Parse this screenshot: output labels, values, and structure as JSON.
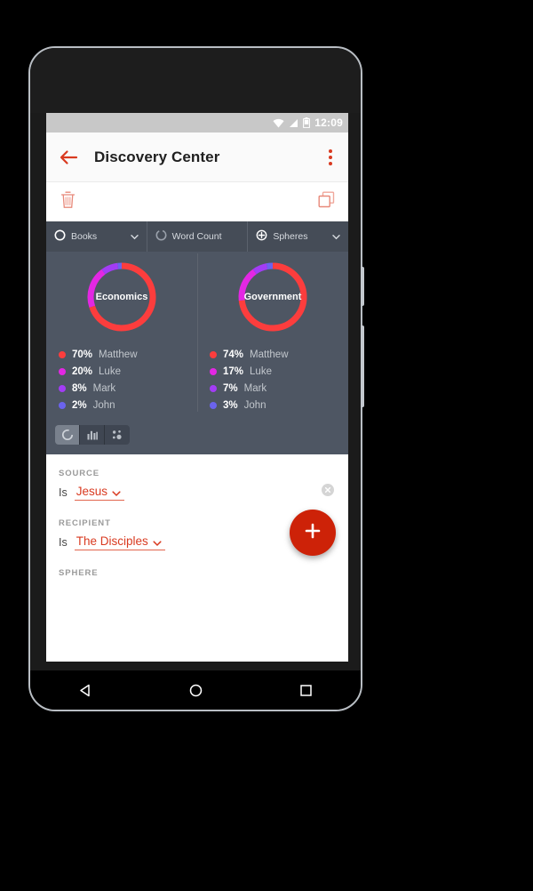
{
  "status_bar": {
    "time": "12:09",
    "icons": [
      "wifi-icon",
      "signal-icon",
      "battery-icon"
    ]
  },
  "app_bar": {
    "back_icon": "back-arrow-icon",
    "title": "Discovery Center",
    "overflow_icon": "overflow-menu-icon"
  },
  "action_toolbar": {
    "delete_icon": "trash-icon",
    "duplicate_icon": "copy-icon"
  },
  "tabs": [
    {
      "label": "Books",
      "icon": "circle-outline-icon",
      "caret": true
    },
    {
      "label": "Word Count",
      "icon": "circle-dashed-icon",
      "caret": false
    },
    {
      "label": "Spheres",
      "icon": "circle-plus-icon",
      "caret": true
    }
  ],
  "view_toggle": {
    "options": [
      "donut-chart-icon",
      "bar-chart-icon",
      "bubble-chart-icon"
    ],
    "active_index": 0
  },
  "filters": [
    {
      "label": "SOURCE",
      "operator": "Is",
      "value": "Jesus",
      "caret_icon": "chevron-down-icon",
      "clear_icon": "clear-circle-icon"
    },
    {
      "label": "RECIPIENT",
      "operator": "Is",
      "value": "The Disciples",
      "caret_icon": "chevron-down-icon"
    },
    {
      "label": "SPHERE"
    }
  ],
  "fab": {
    "icon": "plus-icon",
    "color": "#cd2208"
  },
  "nav_bar": {
    "back_icon": "nav-back-triangle-icon",
    "home_icon": "nav-home-circle-icon",
    "recents_icon": "nav-recents-square-icon"
  },
  "colors": {
    "accent": "#d93a20",
    "panel_bg": "#4e5663",
    "tab_bg": "#454c57",
    "series": [
      "#fc3d3d",
      "#e327e3",
      "#a33cf5",
      "#6b63ee"
    ]
  },
  "chart_data": {
    "type": "pie",
    "title": "",
    "legend_position": "below",
    "charts": [
      {
        "label": "Economics",
        "categories": [
          "Matthew",
          "Luke",
          "Mark",
          "John"
        ],
        "values": [
          70,
          20,
          8,
          2
        ],
        "unit": "%",
        "colors": [
          "#fc3d3d",
          "#e327e3",
          "#a33cf5",
          "#6b63ee"
        ]
      },
      {
        "label": "Government",
        "categories": [
          "Matthew",
          "Luke",
          "Mark",
          "John"
        ],
        "values": [
          74,
          17,
          7,
          3
        ],
        "unit": "%",
        "colors": [
          "#fc3d3d",
          "#e327e3",
          "#a33cf5",
          "#6b63ee"
        ]
      }
    ]
  }
}
